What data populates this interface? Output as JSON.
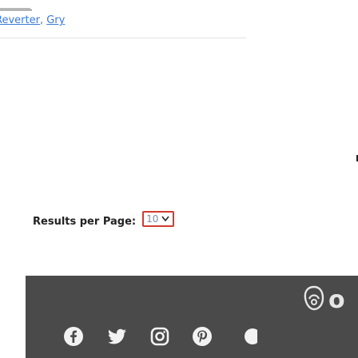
{
  "tags": {
    "items": [
      "Reverter",
      "Gry"
    ],
    "separator": ","
  },
  "pagination": {
    "label": "Results per Page:",
    "selected_value": "10"
  },
  "footer": {
    "logo_text": "o",
    "social_icons": [
      "facebook-icon",
      "twitter-icon",
      "instagram-icon",
      "pinterest-icon"
    ]
  },
  "colors": {
    "link": "#3a7bd5",
    "select_border": "#d33a2f",
    "footer_bg": "#4a4a4a"
  }
}
